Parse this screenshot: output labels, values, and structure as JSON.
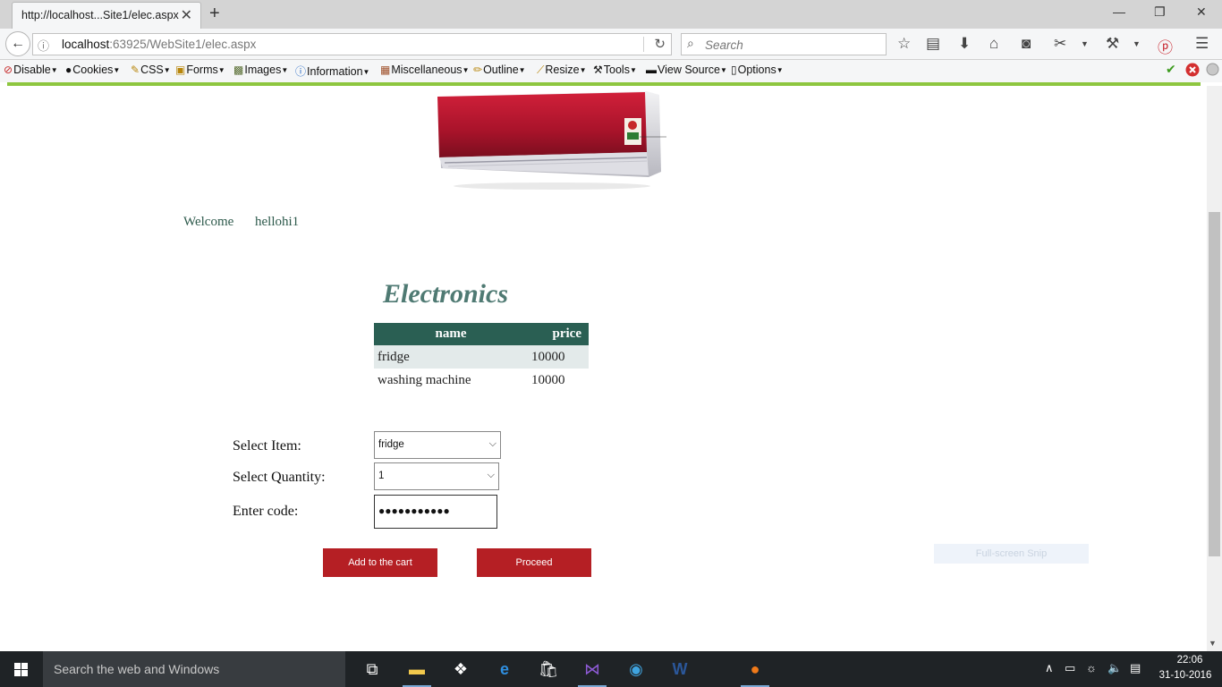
{
  "browser": {
    "tab_title": "http://localhost...Site1/elec.aspx",
    "tab_close": "✕",
    "new_tab": "+",
    "url_host": "localhost",
    "url_rest": ":63925/WebSite1/elec.aspx",
    "search_placeholder": "Search",
    "window_controls": {
      "minimize": "—",
      "restore": "❐",
      "close": "✕"
    }
  },
  "dev_toolbar": {
    "items": [
      "Disable",
      "Cookies",
      "CSS",
      "Forms",
      "Images",
      "Information",
      "Miscellaneous",
      "Outline",
      "Resize",
      "Tools",
      "View Source",
      "Options"
    ],
    "icons": [
      "disable-icon",
      "cookies-icon",
      "css-icon",
      "forms-icon",
      "images-icon",
      "information-icon",
      "miscellaneous-icon",
      "outline-icon",
      "resize-icon",
      "tools-icon",
      "view-source-icon",
      "options-icon"
    ]
  },
  "page": {
    "welcome_label": "Welcome",
    "username": "hellohi1",
    "title": "Electronics",
    "table": {
      "headers": [
        "name",
        "price"
      ],
      "rows": [
        [
          "fridge",
          "10000"
        ],
        [
          "washing machine",
          "10000"
        ]
      ]
    },
    "form": {
      "item_label": "Select Item:",
      "item_value": "fridge",
      "quantity_label": "Select Quantity:",
      "quantity_value": "1",
      "code_label": "Enter code:",
      "code_masked": "●●●●●●●●●●●"
    },
    "buttons": {
      "add_to_cart": "Add to the cart",
      "proceed": "Proceed"
    },
    "snip_label": "Full-screen Snip"
  },
  "taskbar": {
    "search_text": "Search the web and Windows",
    "time": "22:06",
    "date": "31-10-2016"
  },
  "colors": {
    "accent_green": "#8dc63f",
    "table_header": "#2a5f53",
    "button_red": "#b51f24",
    "title_teal": "#4f7a73"
  }
}
